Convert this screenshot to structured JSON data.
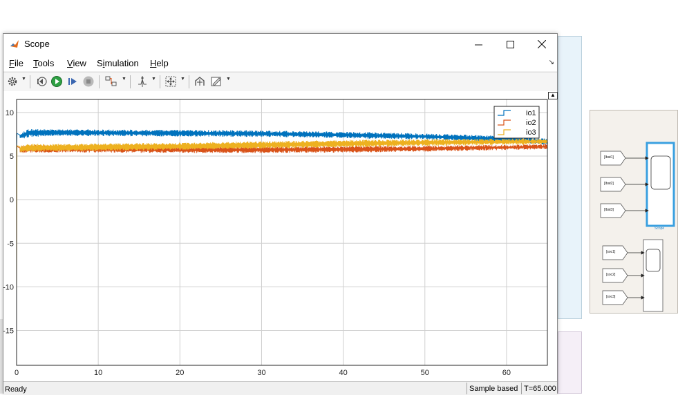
{
  "window": {
    "title": "Scope"
  },
  "menu": {
    "items": [
      {
        "label": "File",
        "accel_index": 0
      },
      {
        "label": "Tools",
        "accel_index": 0
      },
      {
        "label": "View",
        "accel_index": 0
      },
      {
        "label": "Simulation",
        "accel_index": 1
      },
      {
        "label": "Help",
        "accel_index": 0
      }
    ]
  },
  "toolbar": {
    "icons": [
      "settings-icon",
      "step-back-icon",
      "run-icon",
      "step-forward-icon",
      "stop-icon",
      "signal-selector-icon",
      "trigger-icon",
      "zoom-fit-icon",
      "cursor-measurements-icon",
      "style-icon"
    ]
  },
  "colors": {
    "io1": "#0072bd",
    "io2": "#d95319",
    "io3": "#edb120",
    "plot_bg": "#ffffff",
    "grid": "#cfcfcf",
    "window_chrome": "#f0f0f0",
    "selection": "#3aa0e0"
  },
  "chart_data": {
    "type": "line",
    "title": "",
    "xlabel": "",
    "ylabel": "",
    "xlim": [
      0,
      65
    ],
    "ylim": [
      -19,
      11.5
    ],
    "xticks": [
      0,
      10,
      20,
      30,
      40,
      50,
      60
    ],
    "yticks": [
      10,
      5,
      0,
      -5,
      -10,
      -15
    ],
    "grid": true,
    "legend_position": "top-right",
    "series": [
      {
        "name": "io1",
        "color": "#0072bd",
        "x": [
          0,
          0.4,
          1.5,
          5,
          10,
          20,
          30,
          40,
          50,
          60,
          65
        ],
        "upper": [
          5.5,
          7.6,
          8.1,
          8.1,
          8.05,
          8.0,
          7.95,
          7.8,
          7.6,
          7.3,
          7.0
        ],
        "lower": [
          5.5,
          6.9,
          7.2,
          7.3,
          7.3,
          7.25,
          7.2,
          7.05,
          6.9,
          6.6,
          6.3
        ]
      },
      {
        "name": "io2",
        "color": "#d95319",
        "x": [
          0,
          0.4,
          1.5,
          5,
          10,
          20,
          30,
          40,
          50,
          60,
          65
        ],
        "upper": [
          5.5,
          6.1,
          6.3,
          6.2,
          6.15,
          6.1,
          6.1,
          6.15,
          6.2,
          6.3,
          6.4
        ],
        "lower": [
          5.5,
          5.3,
          5.4,
          5.4,
          5.4,
          5.35,
          5.35,
          5.4,
          5.5,
          5.7,
          5.8
        ]
      },
      {
        "name": "io3",
        "color": "#edb120",
        "x": [
          0,
          0.4,
          1.5,
          5,
          10,
          20,
          30,
          40,
          50,
          60,
          65
        ],
        "upper": [
          -11,
          6.2,
          6.4,
          6.4,
          6.45,
          6.55,
          6.7,
          6.85,
          6.95,
          7.0,
          7.0
        ],
        "lower": [
          -11,
          5.4,
          5.5,
          5.55,
          5.6,
          5.7,
          5.85,
          6.0,
          6.15,
          6.3,
          6.35
        ]
      }
    ]
  },
  "status": {
    "left": "Ready",
    "sample_mode": "Sample based",
    "time": "T=65.000"
  },
  "model": {
    "scope1_inputs": [
      "[Ibat1]",
      "[Ibat2]",
      "[Ibat3]"
    ],
    "scope1_label": "Scope",
    "scope2_inputs": [
      "[soc1]",
      "[soc2]",
      "[soc3]"
    ]
  }
}
